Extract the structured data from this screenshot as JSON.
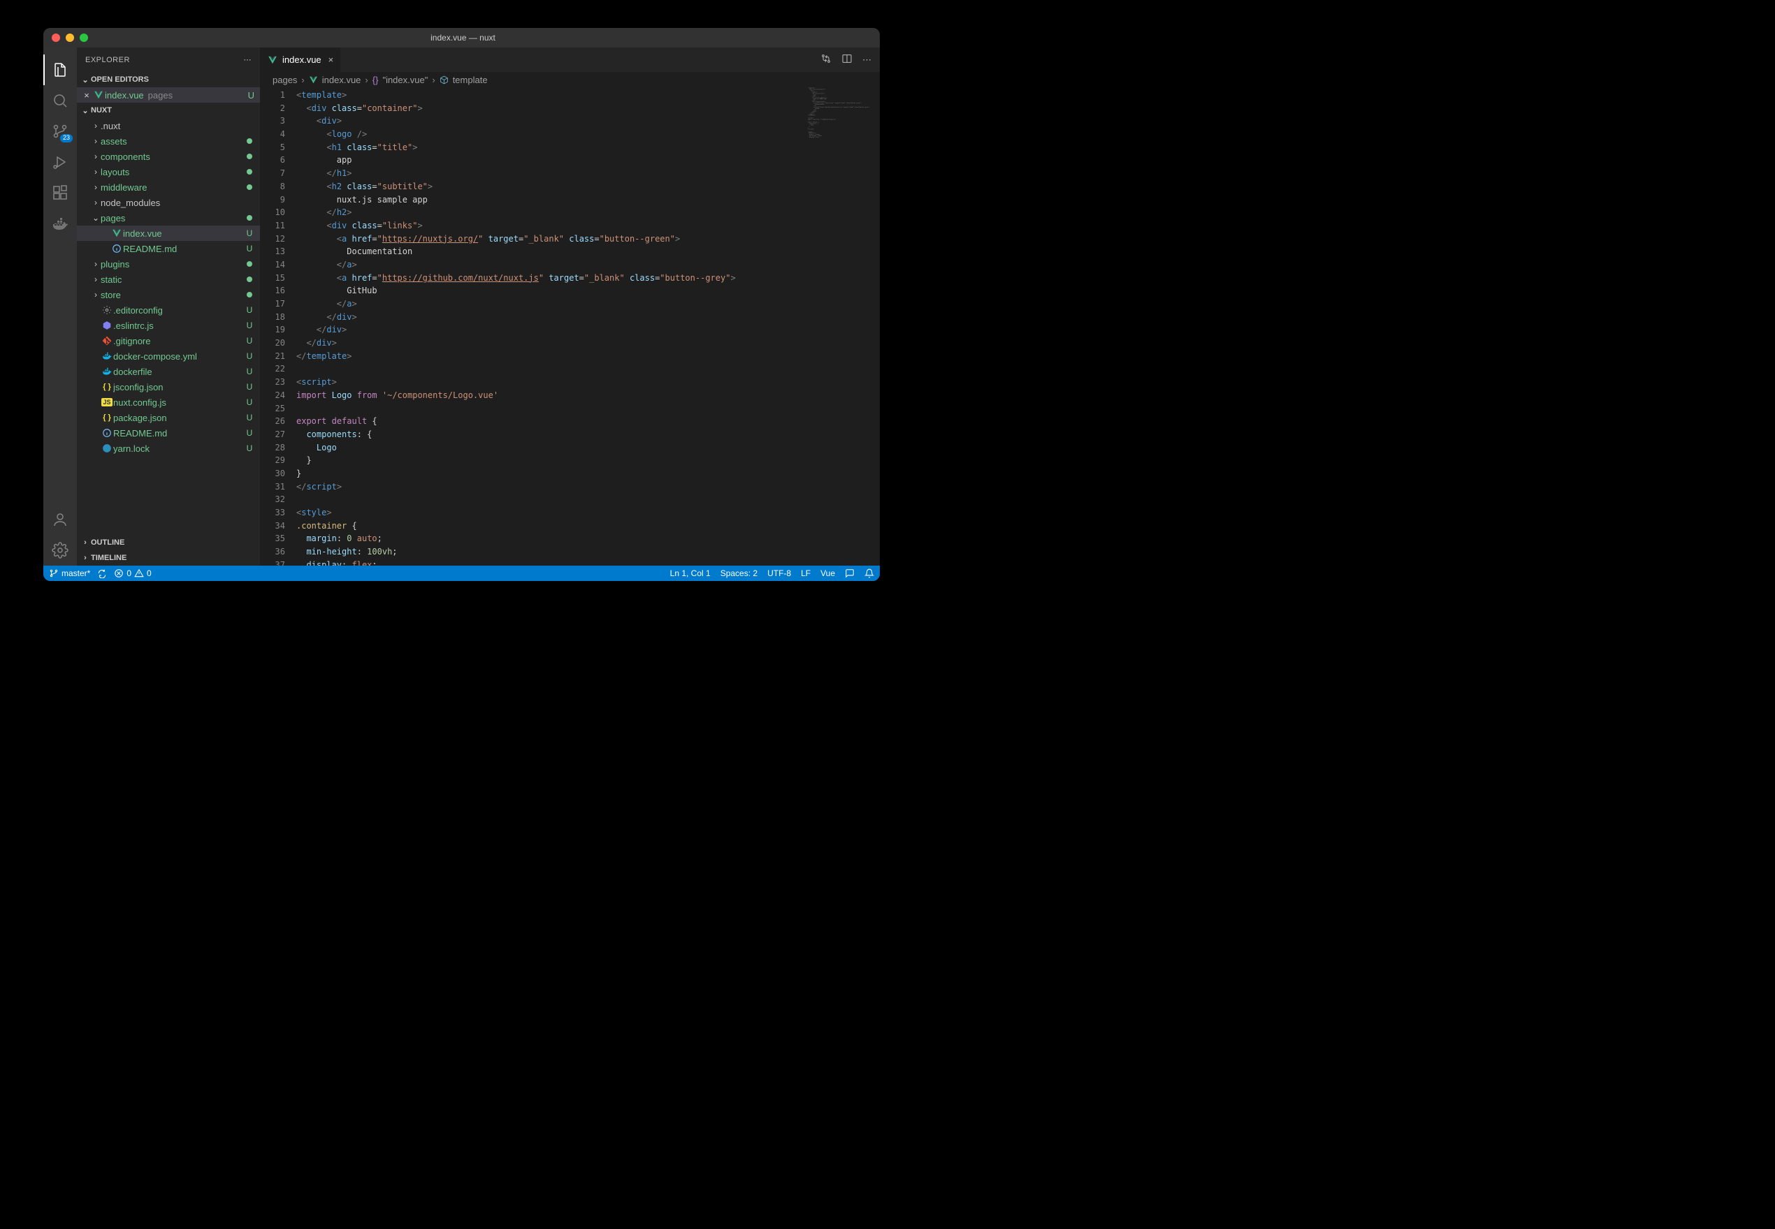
{
  "window": {
    "title": "index.vue — nuxt"
  },
  "explorer": {
    "title": "EXPLORER",
    "openEditorsHeader": "OPEN EDITORS",
    "openEditors": [
      {
        "name": "index.vue",
        "path": "pages",
        "status": "U"
      }
    ],
    "projectName": "NUXT",
    "tree": [
      {
        "type": "folder",
        "name": ".nuxt",
        "depth": 1,
        "expanded": false,
        "status": ""
      },
      {
        "type": "folder",
        "name": "assets",
        "depth": 1,
        "expanded": false,
        "status": "dot"
      },
      {
        "type": "folder",
        "name": "components",
        "depth": 1,
        "expanded": false,
        "status": "dot"
      },
      {
        "type": "folder",
        "name": "layouts",
        "depth": 1,
        "expanded": false,
        "status": "dot"
      },
      {
        "type": "folder",
        "name": "middleware",
        "depth": 1,
        "expanded": false,
        "status": "dot"
      },
      {
        "type": "folder",
        "name": "node_modules",
        "depth": 1,
        "expanded": false,
        "status": ""
      },
      {
        "type": "folder",
        "name": "pages",
        "depth": 1,
        "expanded": true,
        "status": "dot"
      },
      {
        "type": "file",
        "name": "index.vue",
        "depth": 2,
        "icon": "vue",
        "status": "U",
        "active": true
      },
      {
        "type": "file",
        "name": "README.md",
        "depth": 2,
        "icon": "info",
        "status": "U"
      },
      {
        "type": "folder",
        "name": "plugins",
        "depth": 1,
        "expanded": false,
        "status": "dot"
      },
      {
        "type": "folder",
        "name": "static",
        "depth": 1,
        "expanded": false,
        "status": "dot"
      },
      {
        "type": "folder",
        "name": "store",
        "depth": 1,
        "expanded": false,
        "status": "dot"
      },
      {
        "type": "file",
        "name": ".editorconfig",
        "depth": 1,
        "icon": "gear",
        "status": "U"
      },
      {
        "type": "file",
        "name": ".eslintrc.js",
        "depth": 1,
        "icon": "eslint",
        "status": "U"
      },
      {
        "type": "file",
        "name": ".gitignore",
        "depth": 1,
        "icon": "git",
        "status": "U"
      },
      {
        "type": "file",
        "name": "docker-compose.yml",
        "depth": 1,
        "icon": "docker",
        "status": "U"
      },
      {
        "type": "file",
        "name": "dockerfile",
        "depth": 1,
        "icon": "docker",
        "status": "U"
      },
      {
        "type": "file",
        "name": "jsconfig.json",
        "depth": 1,
        "icon": "json",
        "status": "U"
      },
      {
        "type": "file",
        "name": "nuxt.config.js",
        "depth": 1,
        "icon": "js",
        "status": "U"
      },
      {
        "type": "file",
        "name": "package.json",
        "depth": 1,
        "icon": "json",
        "status": "U"
      },
      {
        "type": "file",
        "name": "README.md",
        "depth": 1,
        "icon": "info",
        "status": "U"
      },
      {
        "type": "file",
        "name": "yarn.lock",
        "depth": 1,
        "icon": "yarn",
        "status": "U"
      }
    ],
    "outline": "OUTLINE",
    "timeline": "TIMELINE"
  },
  "activityBadge": "23",
  "tabs": [
    {
      "name": "index.vue",
      "icon": "vue"
    }
  ],
  "breadcrumbs": {
    "p0": "pages",
    "p1": "index.vue",
    "p2": "\"index.vue\"",
    "p3": "template"
  },
  "editor": {
    "lineCount": 37
  },
  "statusbar": {
    "branch": "master*",
    "errors": "0",
    "warnings": "0",
    "position": "Ln 1, Col 1",
    "indent": "Spaces: 2",
    "encoding": "UTF-8",
    "eol": "LF",
    "mode": "Vue"
  }
}
